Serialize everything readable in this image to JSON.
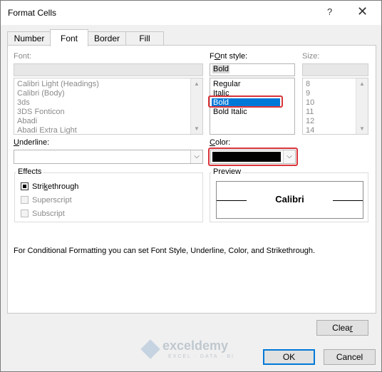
{
  "window": {
    "title": "Format Cells",
    "help_glyph": "?",
    "close_glyph": "✕"
  },
  "tabs": [
    {
      "label": "Number"
    },
    {
      "label": "Font"
    },
    {
      "label": "Border"
    },
    {
      "label": "Fill"
    }
  ],
  "font": {
    "label": "Font:",
    "value": "",
    "items": [
      "Calibri Light (Headings)",
      "Calibri (Body)",
      "3ds",
      "3DS Fonticon",
      "Abadi",
      "Abadi Extra Light"
    ]
  },
  "font_style": {
    "label_accel": "O",
    "label_pre": "F",
    "label_post": "nt style:",
    "value": "Bold",
    "items": [
      "Regular",
      "Italic",
      "Bold",
      "Bold Italic"
    ],
    "selected": "Bold"
  },
  "size": {
    "label": "Size:",
    "value": "",
    "items": [
      "8",
      "9",
      "10",
      "11",
      "12",
      "14"
    ]
  },
  "underline": {
    "label_accel": "U",
    "label_post": "nderline:",
    "value": ""
  },
  "color": {
    "label_accel": "C",
    "label_post": "olor:",
    "swatch": "#000000"
  },
  "effects": {
    "title": "Effects",
    "strikethrough_pre": "Stri",
    "strikethrough_accel": "k",
    "strikethrough_post": "ethrough",
    "strikethrough_checked": true,
    "superscript": "Superscript",
    "subscript": "Subscript"
  },
  "preview": {
    "title": "Preview",
    "text": "Calibri"
  },
  "note": "For Conditional Formatting you can set Font Style, Underline, Color, and Strikethrough.",
  "buttons": {
    "clear_pre": "Clea",
    "clear_accel": "r",
    "ok": "OK",
    "cancel": "Cancel"
  },
  "watermark": {
    "name": "exceldemy",
    "tagline": "EXCEL · DATA · BI"
  },
  "colors": {
    "accent": "#0078d7",
    "highlight": "#d9343a"
  }
}
